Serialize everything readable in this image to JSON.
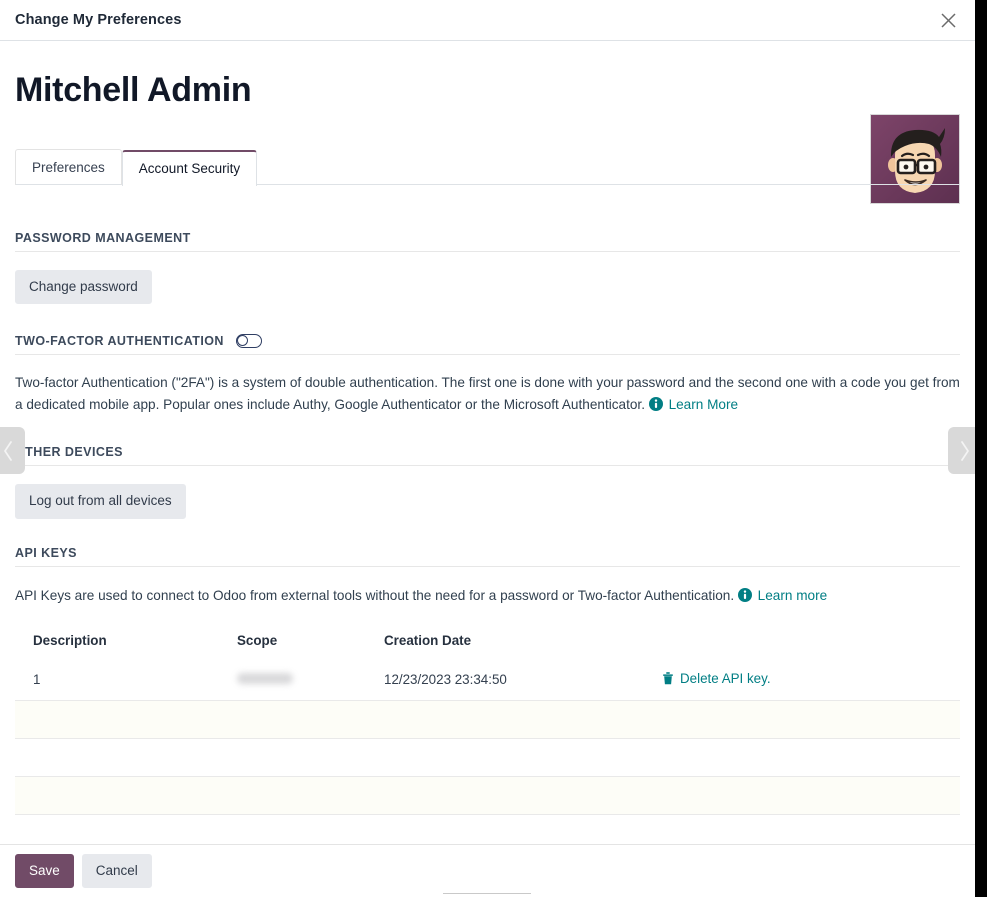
{
  "header": {
    "title": "Change My Preferences",
    "close_icon": "close-icon"
  },
  "record": {
    "name": "Mitchell Admin",
    "avatar_alt": "user-avatar",
    "avatar_bg": "#6d3a5d"
  },
  "tabs": [
    {
      "label": "Preferences",
      "active": false
    },
    {
      "label": "Account Security",
      "active": true
    }
  ],
  "sections": {
    "password": {
      "title": "PASSWORD MANAGEMENT",
      "change_password_label": "Change password"
    },
    "two_factor": {
      "title": "TWO-FACTOR AUTHENTICATION",
      "toggle_state": "off",
      "description": "Two-factor Authentication (\"2FA\") is a system of double authentication. The first one is done with your password and the second one with a code you get from a dedicated mobile app. Popular ones include Authy, Google Authenticator or the Microsoft Authenticator.",
      "learn_more_label": "Learn More",
      "info_icon": "info-circle-icon"
    },
    "other_devices": {
      "title": "OTHER DEVICES",
      "logout_all_label": "Log out from all devices"
    },
    "api_keys": {
      "title": "API KEYS",
      "description": "API Keys are used to connect to Odoo from external tools without the need for a password or Two-factor Authentication.",
      "learn_more_label": "Learn more",
      "info_icon": "info-circle-icon",
      "columns": [
        "Description",
        "Scope",
        "Creation Date",
        ""
      ],
      "rows": [
        {
          "description": "1",
          "scope": "",
          "scope_redacted": true,
          "creation_date": "12/23/2023 23:34:50",
          "action_label": "Delete API key.",
          "action_icon": "trash-icon"
        }
      ],
      "empty_rows": 3
    }
  },
  "scrollers": {
    "left_icon": "chevron-left-icon",
    "right_icon": "chevron-right-icon"
  },
  "footer": {
    "save_label": "Save",
    "cancel_label": "Cancel"
  },
  "colors": {
    "primary": "#714b67",
    "link_teal": "#017e84",
    "secondary_btn": "#e7e9ed"
  }
}
